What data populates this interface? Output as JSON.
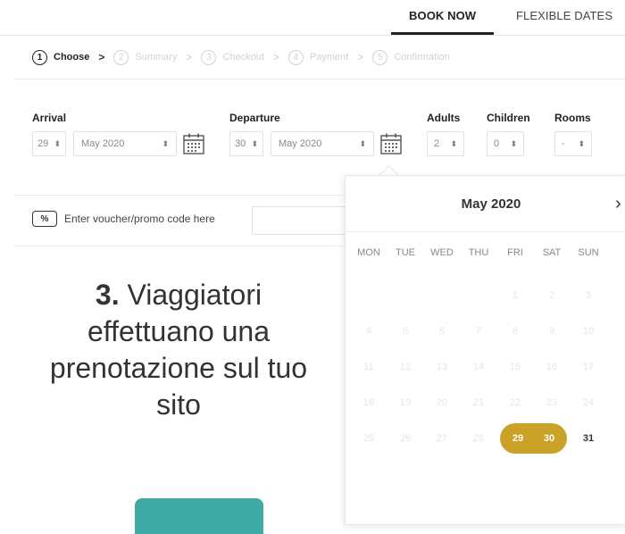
{
  "tabs": {
    "book_now": "BOOK NOW",
    "flexible_dates": "FLEXIBLE DATES"
  },
  "steps": [
    {
      "num": "1",
      "label": "Choose"
    },
    {
      "num": "2",
      "label": "Summary"
    },
    {
      "num": "3",
      "label": "Checkout"
    },
    {
      "num": "4",
      "label": "Payment"
    },
    {
      "num": "5",
      "label": "Confirmation"
    }
  ],
  "step_separator": ">",
  "form": {
    "arrival_label": "Arrival",
    "arrival_day": "29",
    "arrival_month": "May 2020",
    "departure_label": "Departure",
    "departure_day": "30",
    "departure_month": "May 2020",
    "adults_label": "Adults",
    "adults_value": "2",
    "children_label": "Children",
    "children_value": "0",
    "rooms_label": "Rooms",
    "rooms_value": "-",
    "dropdown_arrow": "⬍"
  },
  "voucher": {
    "tag": "%",
    "label": "Enter voucher/promo code here"
  },
  "calendar": {
    "month": "May 2020",
    "next": "›",
    "weekdays": [
      "MON",
      "TUE",
      "WED",
      "THU",
      "FRI",
      "SAT",
      "SUN"
    ],
    "days": [
      "1",
      "2",
      "3",
      "4",
      "5",
      "6",
      "7",
      "8",
      "9",
      "10",
      "11",
      "12",
      "13",
      "14",
      "15",
      "16",
      "17",
      "18",
      "19",
      "20",
      "21",
      "22",
      "23",
      "24",
      "25",
      "26",
      "27",
      "28",
      "29",
      "30",
      "31"
    ],
    "selected_start": "29",
    "selected_end": "30"
  },
  "promo": {
    "number": "3.",
    "text": "Viaggiatori effettuano una prenotazione sul tuo sito"
  },
  "colors": {
    "accent_gold": "#c9a227",
    "cta_teal": "#3fa9a5"
  }
}
